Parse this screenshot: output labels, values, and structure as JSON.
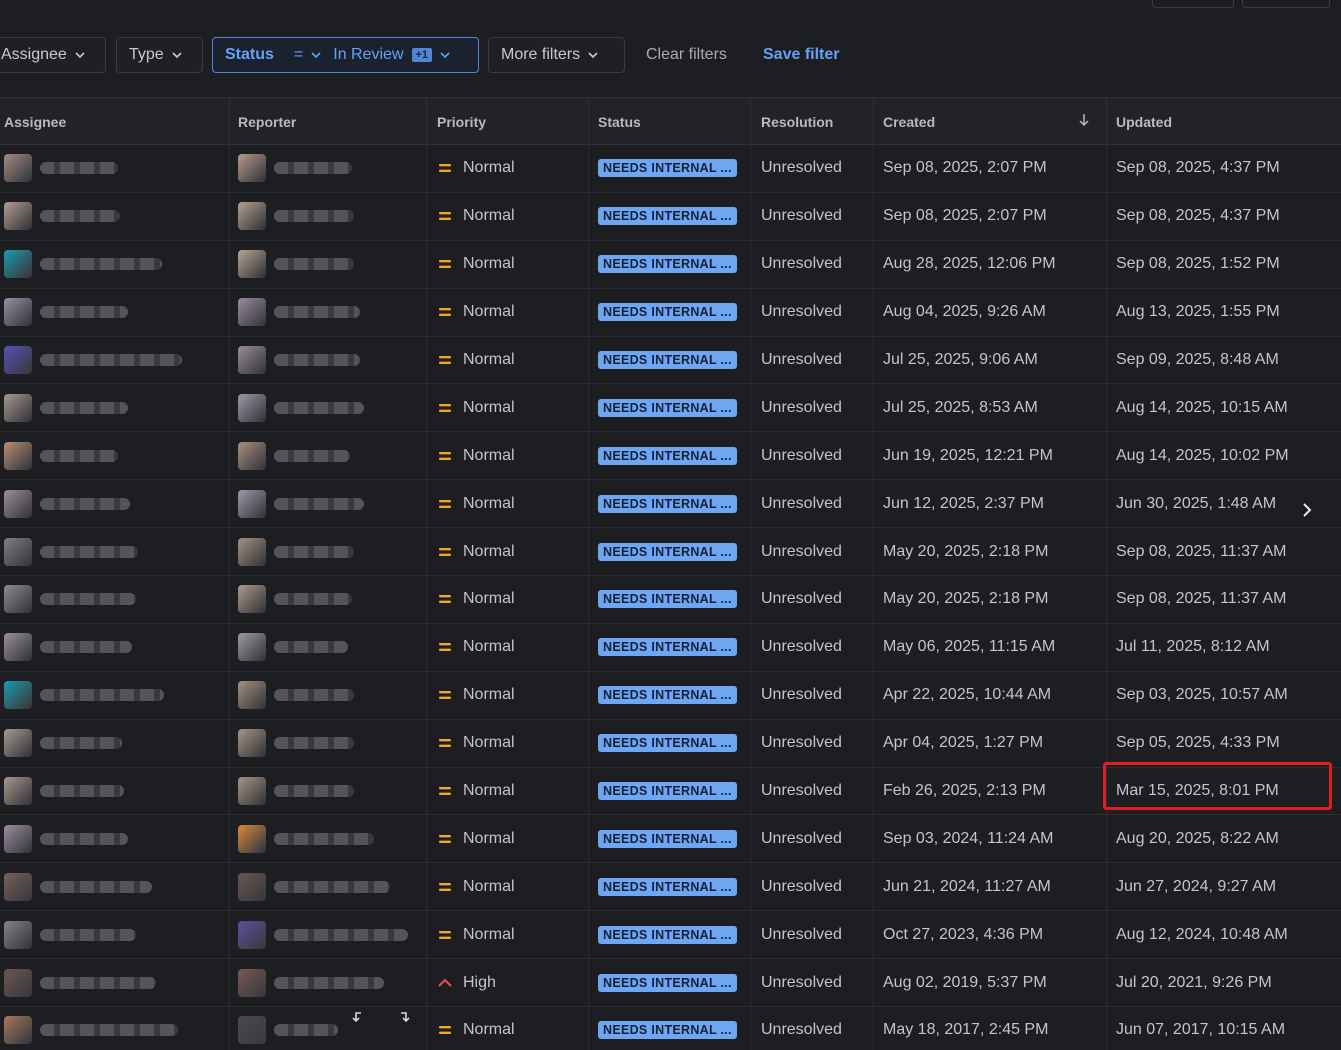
{
  "filters": {
    "assignee": "Assignee",
    "type": "Type",
    "status_label": "Status",
    "status_operator": "=",
    "status_value": "In Review",
    "status_more": "+1",
    "more_filters": "More filters",
    "clear_filters": "Clear filters",
    "save_filter": "Save filter"
  },
  "columns": {
    "assignee": "Assignee",
    "reporter": "Reporter",
    "priority": "Priority",
    "status": "Status",
    "resolution": "Resolution",
    "created": "Created",
    "updated": "Updated"
  },
  "colors": {
    "accent": "#67a1f3",
    "status_bg": "#6fa6f2",
    "priority_normal": "#f5a623",
    "priority_high": "#e5534b",
    "highlight": "#e31b23"
  },
  "rows": [
    {
      "priority": "Normal",
      "status": "NEEDS INTERNAL ...",
      "resolution": "Unresolved",
      "created": "Sep 08, 2025, 2:07 PM",
      "updated": "Sep 08, 2025, 4:37 PM"
    },
    {
      "priority": "Normal",
      "status": "NEEDS INTERNAL ...",
      "resolution": "Unresolved",
      "created": "Sep 08, 2025, 2:07 PM",
      "updated": "Sep 08, 2025, 4:37 PM"
    },
    {
      "priority": "Normal",
      "status": "NEEDS INTERNAL ...",
      "resolution": "Unresolved",
      "created": "Aug 28, 2025, 12:06 PM",
      "updated": "Sep 08, 2025, 1:52 PM"
    },
    {
      "priority": "Normal",
      "status": "NEEDS INTERNAL ...",
      "resolution": "Unresolved",
      "created": "Aug 04, 2025, 9:26 AM",
      "updated": "Aug 13, 2025, 1:55 PM"
    },
    {
      "priority": "Normal",
      "status": "NEEDS INTERNAL ...",
      "resolution": "Unresolved",
      "created": "Jul 25, 2025, 9:06 AM",
      "updated": "Sep 09, 2025, 8:48 AM"
    },
    {
      "priority": "Normal",
      "status": "NEEDS INTERNAL ...",
      "resolution": "Unresolved",
      "created": "Jul 25, 2025, 8:53 AM",
      "updated": "Aug 14, 2025, 10:15 AM"
    },
    {
      "priority": "Normal",
      "status": "NEEDS INTERNAL ...",
      "resolution": "Unresolved",
      "created": "Jun 19, 2025, 12:21 PM",
      "updated": "Aug 14, 2025, 10:02 PM"
    },
    {
      "priority": "Normal",
      "status": "NEEDS INTERNAL ...",
      "resolution": "Unresolved",
      "created": "Jun 12, 2025, 2:37 PM",
      "updated": "Jun 30, 2025, 1:48 AM"
    },
    {
      "priority": "Normal",
      "status": "NEEDS INTERNAL ...",
      "resolution": "Unresolved",
      "created": "May 20, 2025, 2:18 PM",
      "updated": "Sep 08, 2025, 11:37 AM"
    },
    {
      "priority": "Normal",
      "status": "NEEDS INTERNAL ...",
      "resolution": "Unresolved",
      "created": "May 20, 2025, 2:18 PM",
      "updated": "Sep 08, 2025, 11:37 AM"
    },
    {
      "priority": "Normal",
      "status": "NEEDS INTERNAL ...",
      "resolution": "Unresolved",
      "created": "May 06, 2025, 11:15 AM",
      "updated": "Jul 11, 2025, 8:12 AM"
    },
    {
      "priority": "Normal",
      "status": "NEEDS INTERNAL ...",
      "resolution": "Unresolved",
      "created": "Apr 22, 2025, 10:44 AM",
      "updated": "Sep 03, 2025, 10:57 AM"
    },
    {
      "priority": "Normal",
      "status": "NEEDS INTERNAL ...",
      "resolution": "Unresolved",
      "created": "Apr 04, 2025, 1:27 PM",
      "updated": "Sep 05, 2025, 4:33 PM"
    },
    {
      "priority": "Normal",
      "status": "NEEDS INTERNAL ...",
      "resolution": "Unresolved",
      "created": "Feb 26, 2025, 2:13 PM",
      "updated": "Mar 15, 2025, 8:01 PM"
    },
    {
      "priority": "Normal",
      "status": "NEEDS INTERNAL ...",
      "resolution": "Unresolved",
      "created": "Sep 03, 2024, 11:24 AM",
      "updated": "Aug 20, 2025, 8:22 AM"
    },
    {
      "priority": "Normal",
      "status": "NEEDS INTERNAL ...",
      "resolution": "Unresolved",
      "created": "Jun 21, 2024, 11:27 AM",
      "updated": "Jun 27, 2024, 9:27 AM"
    },
    {
      "priority": "Normal",
      "status": "NEEDS INTERNAL ...",
      "resolution": "Unresolved",
      "created": "Oct 27, 2023, 4:36 PM",
      "updated": "Aug 12, 2024, 10:48 AM"
    },
    {
      "priority": "High",
      "status": "NEEDS INTERNAL ...",
      "resolution": "Unresolved",
      "created": "Aug 02, 2019, 5:37 PM",
      "updated": "Jul 20, 2021, 9:26 PM"
    },
    {
      "priority": "Normal",
      "status": "NEEDS INTERNAL ...",
      "resolution": "Unresolved",
      "created": "May 18, 2017, 2:45 PM",
      "updated": "Jun 07, 2017, 10:15 AM"
    }
  ]
}
